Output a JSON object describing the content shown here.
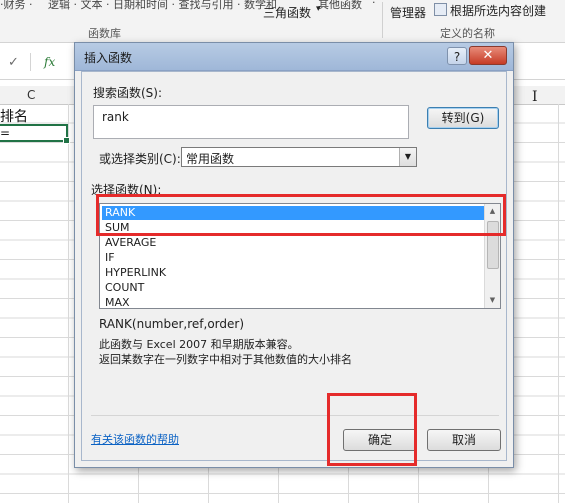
{
  "ribbon": {
    "top_fragments": [
      "·财务 ·",
      "逻辑 · 文本 · 日期和时间 · 查找与引用 · 数学和",
      "其他函数",
      "·"
    ],
    "math_label": "三角函数",
    "name_manager": "管理器",
    "create_from_selection": "根据所选内容创建",
    "group_function_library": "函数库",
    "group_defined_names": "定义的名称"
  },
  "formula_bar": {
    "check": "✓",
    "fx": "fx"
  },
  "sheet": {
    "column_c": "C",
    "cell_c1": "排名",
    "cell_c2": "="
  },
  "dialog": {
    "title": "插入函数",
    "help_btn": "?",
    "close_btn": "✕",
    "search_label": "搜索函数(S):",
    "search_value": "rank",
    "goto_btn": "转到(G)",
    "category_label": "或选择类别(C):",
    "category_value": "常用函数",
    "select_label": "选择函数(N):",
    "functions": [
      "RANK",
      "SUM",
      "AVERAGE",
      "IF",
      "HYPERLINK",
      "COUNT",
      "MAX"
    ],
    "signature": "RANK(number,ref,order)",
    "desc1": "此函数与 Excel 2007 和早期版本兼容。",
    "desc2": "返回某数字在一列数字中相对于其他数值的大小排名",
    "help_link": "有关该函数的帮助",
    "ok_btn": "确定",
    "cancel_btn": "取消"
  },
  "colors": {
    "selection": "#3399ff",
    "annotation": "#e52b2b",
    "excel_green": "#217346"
  }
}
